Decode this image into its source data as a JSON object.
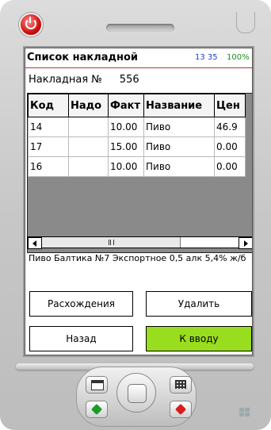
{
  "window": {
    "title": "Список накладной",
    "time": "13 35",
    "battery": "100%"
  },
  "invoice": {
    "label": "Накладная №",
    "number": "556"
  },
  "table": {
    "headers": [
      "Код",
      "Надо",
      "Факт",
      "Название",
      "Цен"
    ],
    "rows": [
      [
        "14",
        "",
        "10.00",
        "Пиво",
        "46.9"
      ],
      [
        "17",
        "",
        "15.00",
        "Пиво",
        "0.00"
      ],
      [
        "16",
        "",
        "10.00",
        "Пиво",
        "0.00"
      ]
    ]
  },
  "description": "Пиво Балтика №7 Экспортное 0,5 алк 5,4% ж/б",
  "buttons": {
    "discrepancies": "Расхождения",
    "delete": "Удалить",
    "back": "Назад",
    "to_input": "К вводу"
  },
  "colors": {
    "accent_green": "#99dd1f",
    "time_blue": "#1b3fd1",
    "battery_green": "#1a8f1a",
    "title_underline": "#c03030"
  }
}
